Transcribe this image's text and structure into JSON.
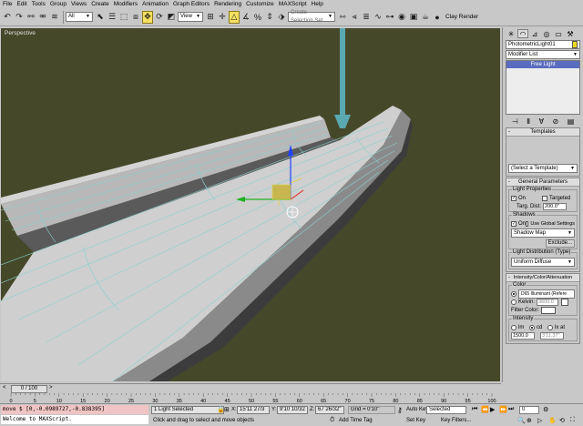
{
  "menu": [
    "File",
    "Edit",
    "Tools",
    "Group",
    "Views",
    "Create",
    "Modifiers",
    "Animation",
    "Graph Editors",
    "Rendering",
    "Customize",
    "MAXScript",
    "Help"
  ],
  "toolbar": {
    "filter_select": "All",
    "coord_select": "View",
    "selection_set_placeholder": "Create Selection Set",
    "clay_render_label": "Clay Render"
  },
  "viewport": {
    "label": "Perspective",
    "background": "#46482a",
    "wire_color": "#8ad0d0"
  },
  "command_panel": {
    "object_name": "PhotometricLight01",
    "object_color": "#f0d820",
    "modifier_list": "Modifier List",
    "stack_item": "Free Light",
    "templates": {
      "title": "Templates",
      "select_value": "(Select a Template)"
    },
    "general": {
      "title": "General Parameters",
      "light_properties_label": "Light Properties",
      "on_label": "On",
      "targeted_label": "Targeted",
      "targ_dist_label": "Targ. Dist:",
      "targ_dist_value": "200.0\"",
      "shadows_label": "Shadows",
      "shadows_on_label": "On",
      "use_global_label": "Use Global Settings",
      "shadow_type": "Shadow Map",
      "exclude_label": "Exclude...",
      "distribution_label": "Light Distribution (Type)",
      "distribution_value": "Uniform Diffuse"
    },
    "intensity": {
      "title": "Intensity/Color/Attenuation",
      "color_label": "Color",
      "color_preset": "D65 Illuminant (Refere",
      "kelvin_label": "Kelvin:",
      "kelvin_value": "3600.0",
      "filter_color_label": "Filter Color:",
      "intensity_label": "Intensity",
      "lm_label": "lm",
      "cd_label": "cd",
      "lx_label": "lx at",
      "intensity_value": "1500.0",
      "distance_value": "3'11.37\""
    }
  },
  "timebar": {
    "slider_text": "0 / 100",
    "ticks": [
      "0",
      "5",
      "10",
      "15",
      "20",
      "25",
      "30",
      "35",
      "40",
      "45",
      "50",
      "55",
      "60",
      "65",
      "70",
      "75",
      "80",
      "85",
      "90",
      "95",
      "100"
    ]
  },
  "status": {
    "listener_line1": "move $ [0,-0.0989727,-0.838395]",
    "listener_line2": "Welcome to MAXScript.",
    "selection": "1 Light Selected",
    "prompt": "Click and drag to select and move objects",
    "x_label": "X:",
    "x_value": "15'11 27/3",
    "y_label": "Y:",
    "y_value": "9'10 10/32",
    "z_label": "Z:",
    "z_value": "67 26/32\"",
    "grid": "Grid = 0'10\"",
    "add_time_tag": "Add Time Tag",
    "auto_key": "Auto Key",
    "selected": "Selected",
    "set_key": "Set Key",
    "key_filters": "Key Filters...",
    "frame_value": "0"
  }
}
